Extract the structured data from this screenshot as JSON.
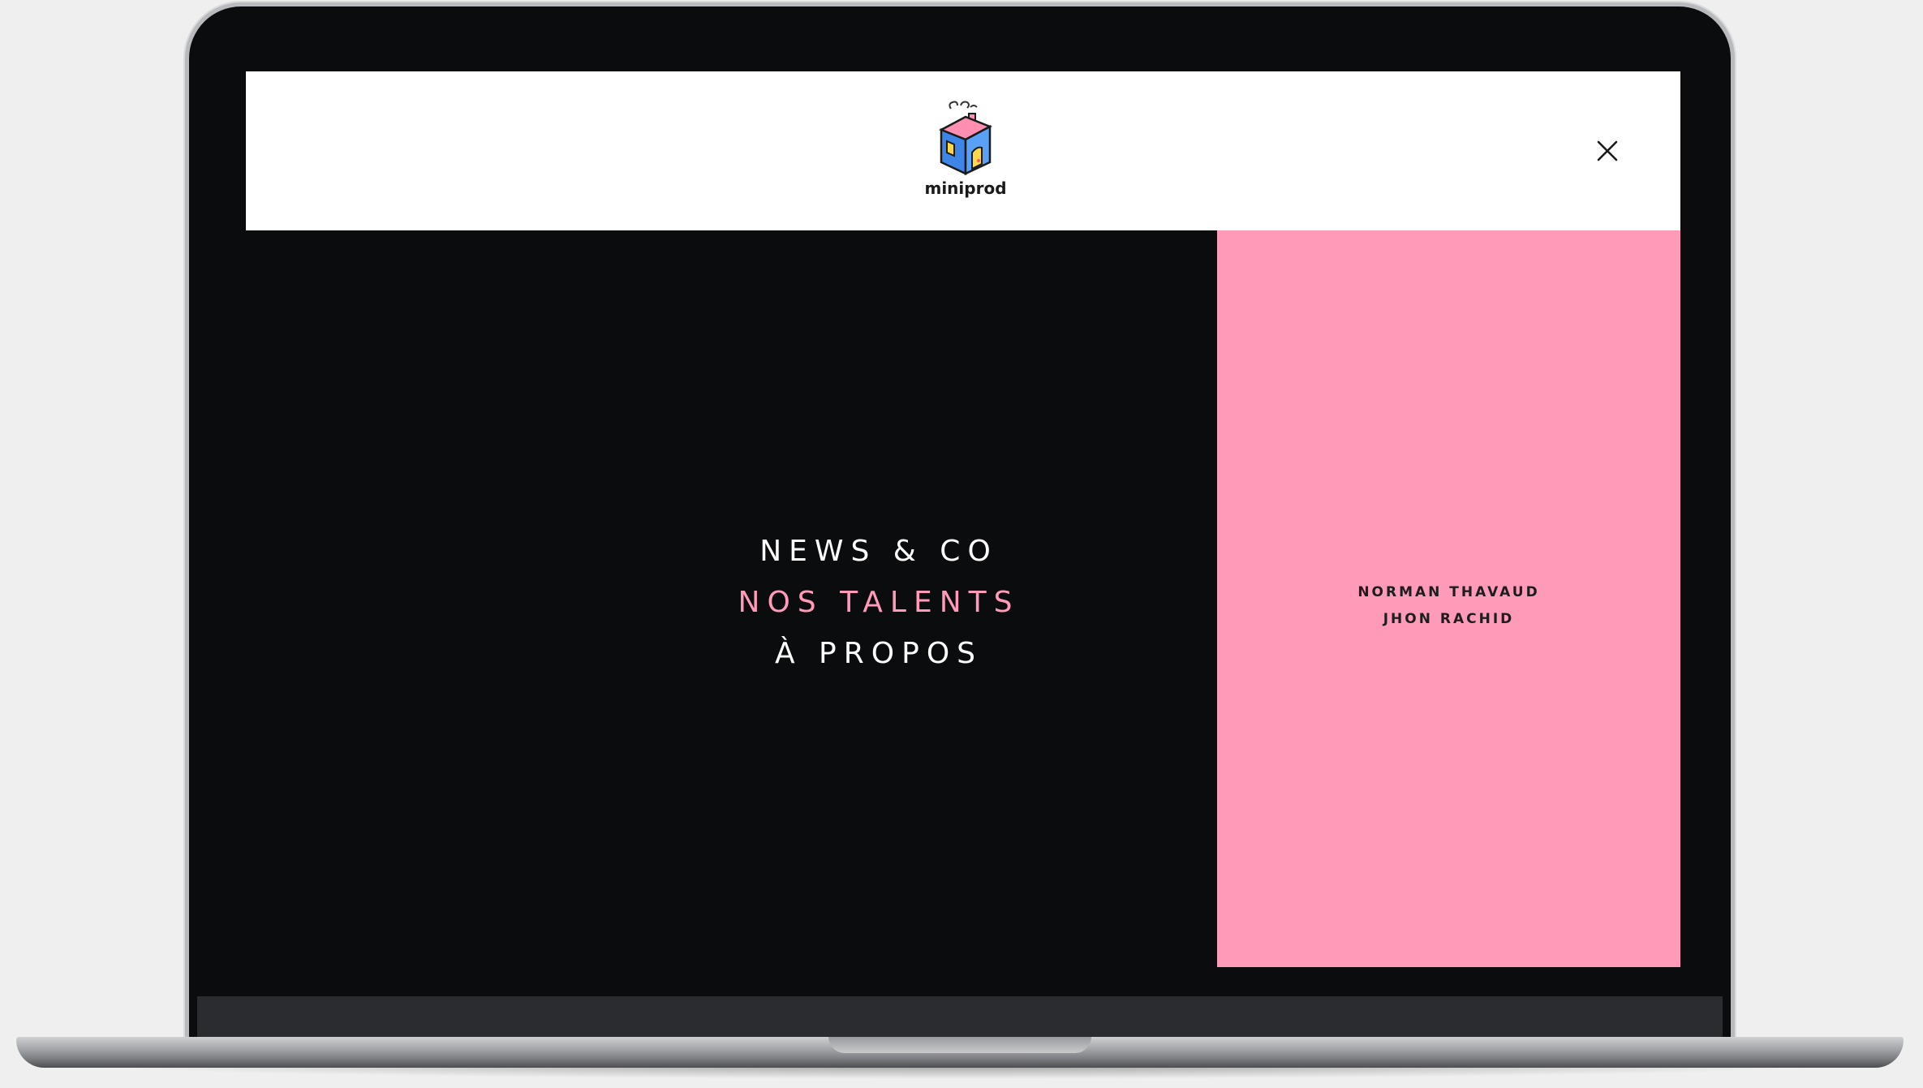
{
  "brand": {
    "name": "miniprod"
  },
  "header": {
    "close_label": "×"
  },
  "nav": {
    "items": [
      {
        "label": "NEWS & CO",
        "active": false
      },
      {
        "label": "NOS TALENTS",
        "active": true
      },
      {
        "label": "À PROPOS",
        "active": false
      }
    ]
  },
  "talents": {
    "items": [
      {
        "label": "NORMAN THAVAUD"
      },
      {
        "label": "JHON RACHID"
      }
    ]
  },
  "colors": {
    "accent_pink": "#ff9ab8",
    "background": "#0b0c0e",
    "header_bg": "#ffffff"
  },
  "icons": {
    "logo": "house-logo-icon",
    "close": "close-icon"
  }
}
